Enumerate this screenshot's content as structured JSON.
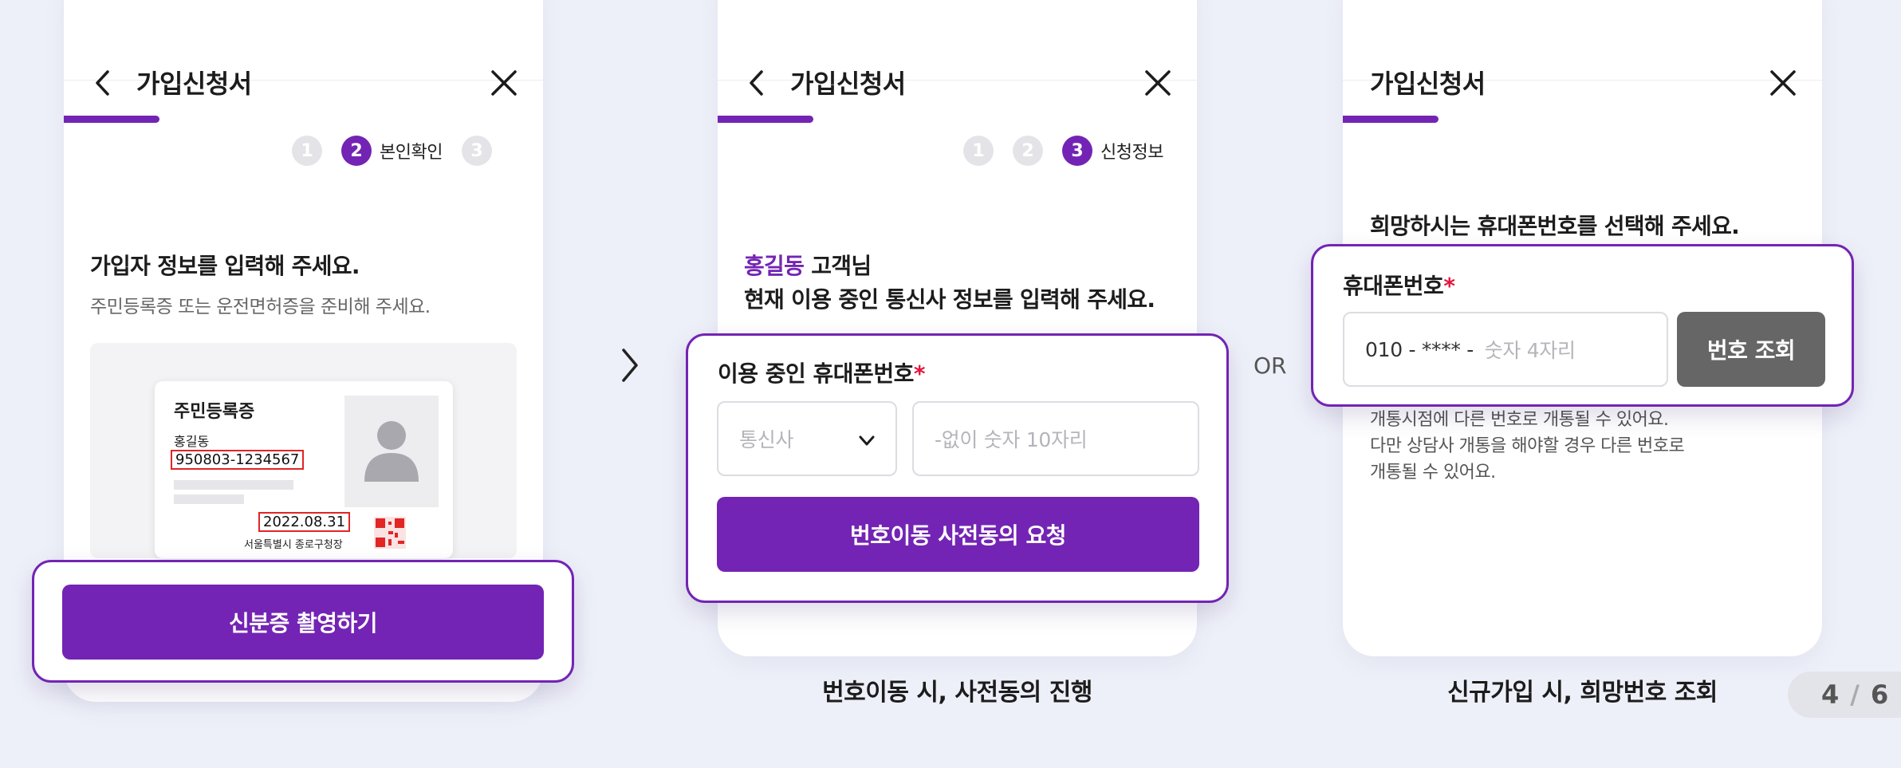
{
  "colors": {
    "brand": "#7324b4",
    "required": "#e5143c",
    "background": "#eef0f9"
  },
  "screen1": {
    "title": "가입신청서",
    "steps": [
      "1",
      "2",
      "3"
    ],
    "active_step_label": "본인확인",
    "heading": "가입자 정보를 입력해 주세요.",
    "subtext": "주민등록증 또는 운전면허증을 준비해 주세요.",
    "id_card": {
      "title": "주민등록증",
      "name": "홍길동",
      "number": "950803-1234567",
      "date": "2022.08.31",
      "issuer": "서울특별시 종로구청장"
    },
    "button": "신분증 촬영하기"
  },
  "arrow_icon": "chevron-right-icon",
  "screen2": {
    "title": "가입신청서",
    "steps": [
      "1",
      "2",
      "3"
    ],
    "active_step_label": "신청정보",
    "customer_name": "홍길동",
    "customer_suffix": " 고객님",
    "heading": "현재 이용 중인 통신사 정보를 입력해 주세요.",
    "field_label": "이용 중인 휴대폰번호",
    "required_mark": "*",
    "carrier_placeholder": "통신사",
    "number_placeholder": "-없이 숫자 10자리",
    "button": "번호이동 사전동의 요청",
    "caption": "번호이동 시, 사전동의 진행"
  },
  "or_label": "OR",
  "screen3": {
    "title": "가입신청서",
    "heading": "희망하시는 휴대폰번호를 선택해 주세요.",
    "field_label": "휴대폰번호",
    "required_mark": "*",
    "number_prefix": "010 - **** - ",
    "number_placeholder": "숫자 4자리",
    "lookup_button": "번호 조회",
    "notes": [
      "개통시점에 다른 번호로 개통될 수 있어요.",
      "다만 상담사 개통을 해야할 경우 다른 번호로",
      "개통될 수 있어요."
    ],
    "caption": "신규가입 시, 희망번호 조회"
  },
  "pagination": {
    "current": "4",
    "separator": "/",
    "total": "6"
  }
}
